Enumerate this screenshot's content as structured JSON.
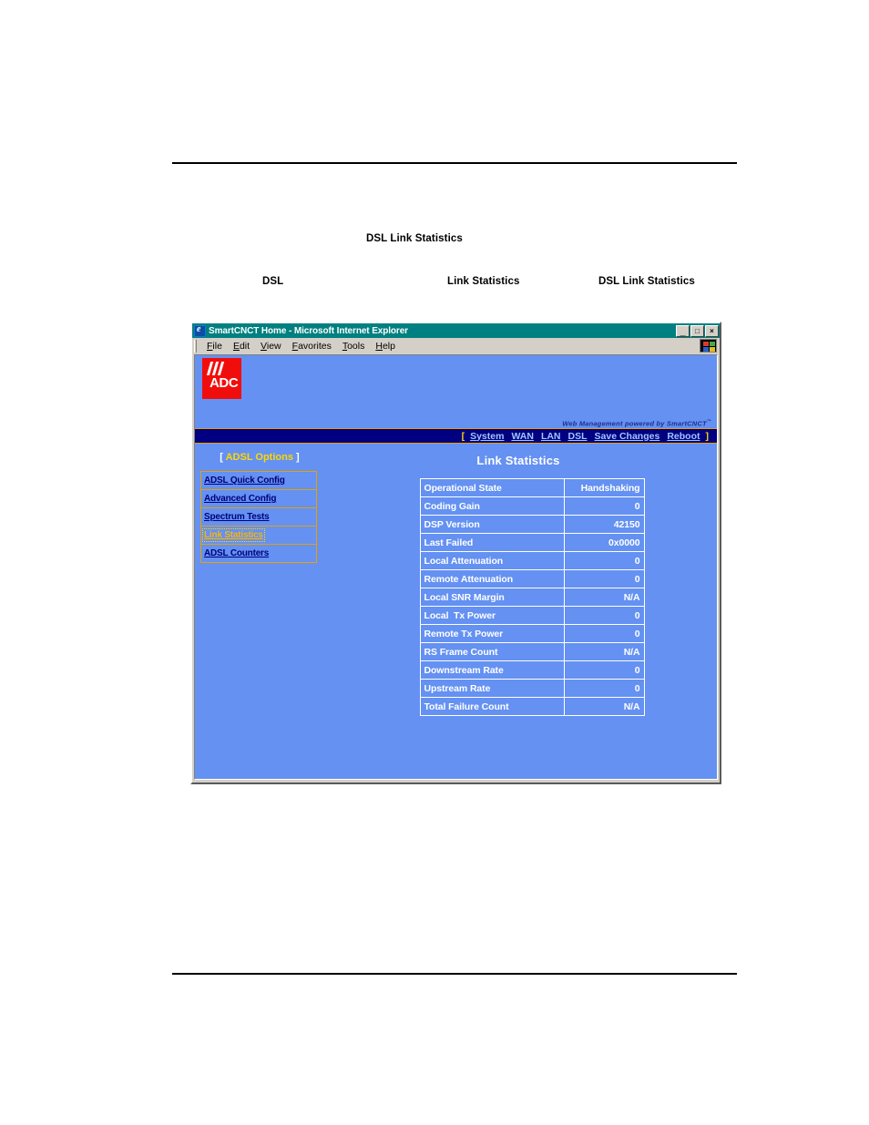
{
  "document": {
    "title": "DSL Link Statistics",
    "terms": [
      "DSL",
      "Link Statistics",
      "DSL Link Statistics"
    ]
  },
  "browser": {
    "title": "SmartCNCT Home - Microsoft Internet Explorer",
    "title_icon": "internet-explorer-icon",
    "window_buttons": [
      {
        "name": "minimize",
        "glyph": "_"
      },
      {
        "name": "maximize",
        "glyph": "□"
      },
      {
        "name": "close",
        "glyph": "×"
      }
    ],
    "menu": [
      {
        "accel": "F",
        "rest": "ile"
      },
      {
        "accel": "E",
        "rest": "dit"
      },
      {
        "accel": "V",
        "rest": "iew"
      },
      {
        "accel": "F",
        "rest": "avorites",
        "pre": ""
      },
      {
        "accel": "T",
        "rest": "ools"
      },
      {
        "accel": "H",
        "rest": "elp"
      }
    ],
    "toolbar_logo": "windows-flag-icon"
  },
  "page": {
    "brand": {
      "logo_text": "ADC",
      "logo_name": "adc-logo",
      "tagline": "Web Management powered by SmartCNCT",
      "tagline_tm": "™"
    },
    "nav": {
      "open_bracket": "[",
      "close_bracket": "]",
      "links": [
        "System",
        "WAN",
        "LAN",
        "DSL",
        "Save Changes",
        "Reboot"
      ]
    },
    "sidebar": {
      "open_bracket": "[ ",
      "title": "ADSL Options",
      "close_bracket": " ]",
      "items": [
        {
          "label": "ADSL Quick Config",
          "active": false
        },
        {
          "label": "Advanced Config",
          "active": false
        },
        {
          "label": "Spectrum Tests",
          "active": false
        },
        {
          "label": "Link Statistics",
          "active": true
        },
        {
          "label": "ADSL Counters",
          "active": false
        }
      ]
    },
    "main": {
      "title": "Link Statistics",
      "stats": [
        {
          "key": "Operational State",
          "value": "Handshaking"
        },
        {
          "key": "Coding Gain",
          "value": "0"
        },
        {
          "key": "DSP Version",
          "value": "42150"
        },
        {
          "key": "Last Failed",
          "value": "0x0000"
        },
        {
          "key": "Local Attenuation",
          "value": "0"
        },
        {
          "key": "Remote Attenuation",
          "value": "0"
        },
        {
          "key": "Local SNR Margin",
          "value": "N/A"
        },
        {
          "key": "Local  Tx Power",
          "value": "0"
        },
        {
          "key": "Remote Tx Power",
          "value": "0"
        },
        {
          "key": "RS Frame Count",
          "value": "N/A"
        },
        {
          "key": "Downstream Rate",
          "value": "0"
        },
        {
          "key": "Upstream Rate",
          "value": "0"
        },
        {
          "key": "Total Failure Count",
          "value": "N/A"
        }
      ]
    }
  },
  "colors": {
    "page_background": "#6491f2",
    "nav_background": "#000080",
    "nav_border": "#e8a000",
    "accent_yellow": "#ffd700",
    "link_blue": "#00007a",
    "logo_red": "#f20d0d",
    "titlebar_teal": "#008080"
  }
}
